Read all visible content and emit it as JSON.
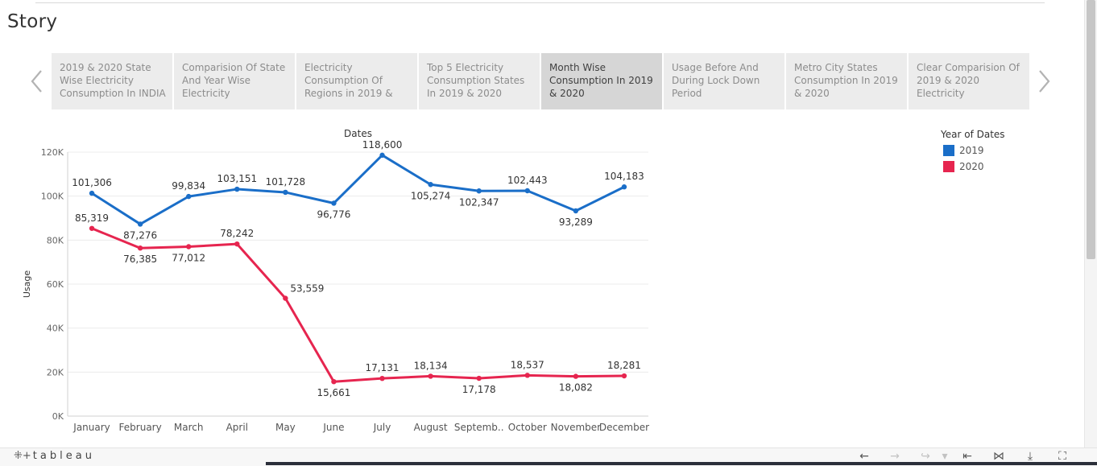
{
  "story": {
    "title": "Story"
  },
  "tabs": [
    {
      "label": "2019 & 2020 State Wise Electricity Consumption In INDIA",
      "active": false
    },
    {
      "label": "Comparision Of State And Year Wise Electricity",
      "active": false
    },
    {
      "label": "Electricity Consumption Of Regions in 2019 &",
      "active": false
    },
    {
      "label": "Top 5 Electricity Consumption States In 2019 & 2020",
      "active": false
    },
    {
      "label": "Month Wise Consumption In 2019 & 2020",
      "active": true
    },
    {
      "label": "Usage Before And During Lock Down Period",
      "active": false
    },
    {
      "label": "Metro City States Consumption In 2019 & 2020",
      "active": false
    },
    {
      "label": "Clear Comparision Of 2019 & 2020 Electricity",
      "active": false
    }
  ],
  "nav": {
    "prev_icon": "chevron-left-icon",
    "next_icon": "chevron-right-icon"
  },
  "legend": {
    "title": "Year of Dates",
    "items": [
      {
        "label": "2019",
        "color": "#1a6ec8"
      },
      {
        "label": "2020",
        "color": "#e6254f"
      }
    ]
  },
  "chart_data": {
    "type": "line",
    "title": "Dates",
    "xlabel": "Dates",
    "ylabel": "Usage",
    "categories": [
      "January",
      "February",
      "March",
      "April",
      "May",
      "June",
      "July",
      "August",
      "Septemb..",
      "October",
      "November",
      "December"
    ],
    "y_ticks": [
      "0K",
      "20K",
      "40K",
      "60K",
      "80K",
      "100K",
      "120K"
    ],
    "ylim": [
      0,
      120000
    ],
    "grid": true,
    "legend_position": "right",
    "series": [
      {
        "name": "2019",
        "color": "#1a6ec8",
        "values": [
          101306,
          87276,
          99834,
          103151,
          101728,
          96776,
          118600,
          105274,
          102347,
          102443,
          93289,
          104183
        ],
        "labels": [
          "101,306",
          "87,276",
          "99,834",
          "103,151",
          "101,728",
          "96,776",
          "118,600",
          "105,274",
          "102,347",
          "102,443",
          "93,289",
          "104,183"
        ]
      },
      {
        "name": "2020",
        "color": "#e6254f",
        "values": [
          85319,
          76385,
          77012,
          78242,
          53559,
          15661,
          17131,
          18134,
          17178,
          18537,
          18082,
          18281
        ],
        "labels": [
          "85,319",
          "76,385",
          "77,012",
          "78,242",
          "53,559",
          "15,661",
          "17,131",
          "18,134",
          "17,178",
          "18,537",
          "18,082",
          "18,281"
        ]
      }
    ]
  },
  "footer": {
    "logo": "tableau",
    "tools": [
      {
        "name": "undo-icon",
        "glyph": "←",
        "enabled": true
      },
      {
        "name": "redo-icon",
        "glyph": "→",
        "enabled": false
      },
      {
        "name": "revert-icon",
        "glyph": "↪",
        "enabled": false
      },
      {
        "name": "dropdown-icon",
        "glyph": "▾",
        "enabled": false
      },
      {
        "name": "reset-icon",
        "glyph": "⇤",
        "enabled": true
      },
      {
        "name": "share-icon",
        "glyph": "⋈",
        "enabled": true
      },
      {
        "name": "download-icon",
        "glyph": "⤓",
        "enabled": true
      },
      {
        "name": "fullscreen-icon",
        "glyph": "⛶",
        "enabled": true
      }
    ]
  }
}
